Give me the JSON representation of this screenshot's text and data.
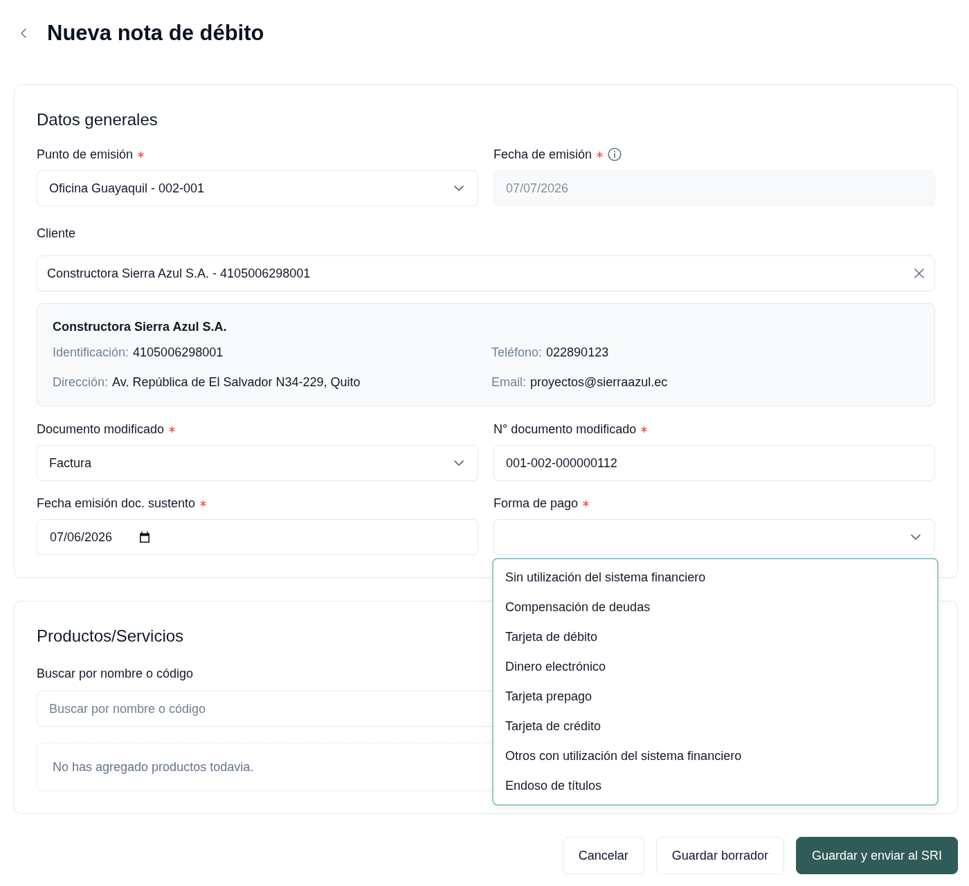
{
  "header": {
    "title": "Nueva nota de débito"
  },
  "datos_generales": {
    "title": "Datos generales",
    "punto_emision": {
      "label": "Punto de emisión",
      "required": true,
      "value": "Oficina Guayaquil - 002-001"
    },
    "fecha_emision": {
      "label": "Fecha de emisión",
      "required": true,
      "disabled": true,
      "value": "07/07/2026"
    },
    "cliente": {
      "label": "Cliente",
      "value": "Constructora Sierra Azul S.A. - 4105006298001"
    },
    "cliente_info": {
      "name": "Constructora Sierra Azul S.A.",
      "details": [
        {
          "label": "Identificación:",
          "value": "4105006298001"
        },
        {
          "label": "Teléfono:",
          "value": "022890123"
        },
        {
          "label": "Dirección:",
          "value": "Av. República de El Salvador N34-229, Quito"
        },
        {
          "label": "Email:",
          "value": "proyectos@sierraazul.ec"
        }
      ]
    },
    "documento_modificado": {
      "label": "Documento modificado",
      "required": true,
      "value": "Factura"
    },
    "numero_documento": {
      "label": "N° documento modificado",
      "required": true,
      "value": "001-002-000000112"
    },
    "fecha_sustento": {
      "label": "Fecha emisión doc. sustento",
      "required": true,
      "value": "07/06/2026"
    },
    "forma_pago": {
      "label": "Forma de pago",
      "required": true,
      "expanded": true,
      "options": [
        {
          "label": "Sin utilización del sistema financiero",
          "selected": false
        },
        {
          "label": "Compensación de deudas",
          "selected": false
        },
        {
          "label": "Tarjeta de débito",
          "selected": false
        },
        {
          "label": "Dinero electrónico",
          "selected": false
        },
        {
          "label": "Tarjeta prepago",
          "selected": false
        },
        {
          "label": "Tarjeta de crédito",
          "selected": false
        },
        {
          "label": "Otros con utilización del sistema financiero",
          "selected": false
        },
        {
          "label": "Endoso de títulos",
          "selected": false
        }
      ]
    }
  },
  "productos": {
    "title": "Productos/Servicios",
    "search": {
      "label": "Buscar por nombre o código",
      "placeholder": "Buscar por nombre o código"
    },
    "empty_message": "No has agregado productos todavia."
  },
  "actions": [
    {
      "label": "Cancelar",
      "kind": "secondary"
    },
    {
      "label": "Guardar borrador",
      "kind": "secondary"
    },
    {
      "label": "Guardar y enviar al SRI",
      "kind": "primary"
    }
  ]
}
